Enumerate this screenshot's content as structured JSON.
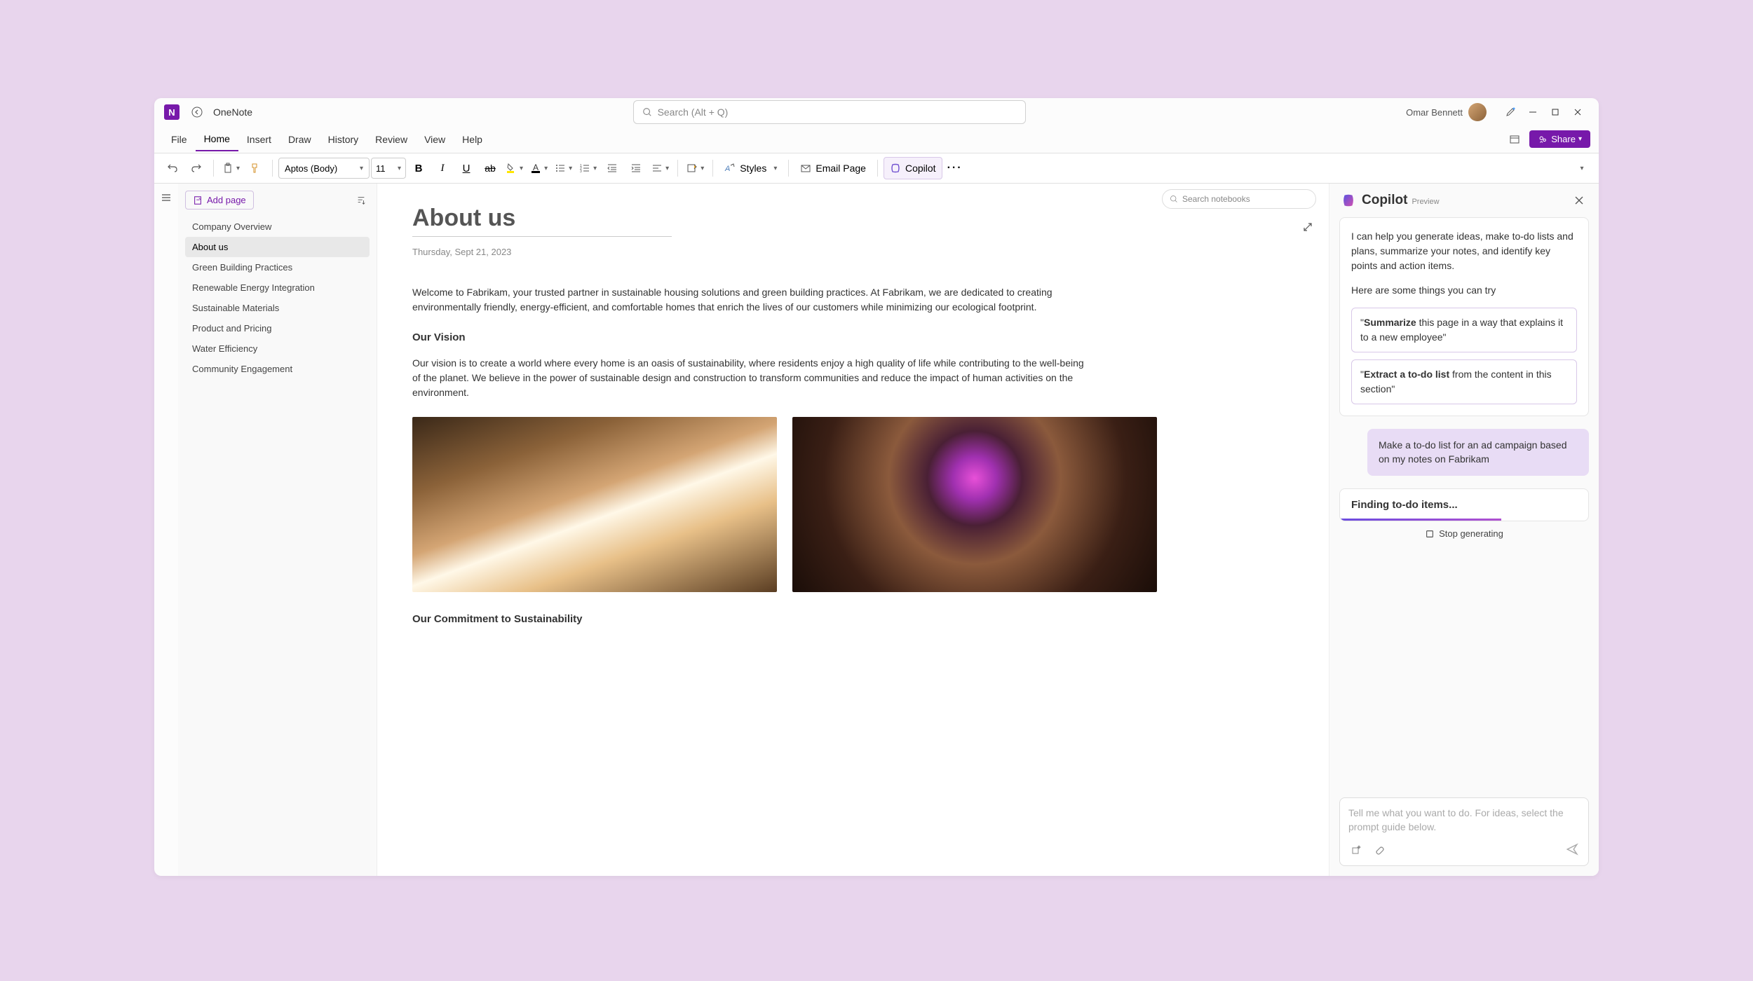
{
  "app": {
    "name": "OneNote"
  },
  "search": {
    "placeholder": "Search (Alt + Q)"
  },
  "user": {
    "name": "Omar Bennett"
  },
  "menu": {
    "items": [
      "File",
      "Home",
      "Insert",
      "Draw",
      "History",
      "Review",
      "View",
      "Help"
    ],
    "active": "Home"
  },
  "share": {
    "label": "Share"
  },
  "ribbon": {
    "font": "Aptos (Body)",
    "size": "11",
    "styles": "Styles",
    "email": "Email Page",
    "copilot": "Copilot"
  },
  "notebookSearch": {
    "placeholder": "Search notebooks"
  },
  "sidebar": {
    "addPage": "Add page",
    "items": [
      "Company Overview",
      "About us",
      "Green Building Practices",
      "Renewable Energy Integration",
      "Sustainable Materials",
      "Product and Pricing",
      "Water Efficiency",
      "Community Engagement"
    ],
    "active": 1
  },
  "page": {
    "title": "About us",
    "date": "Thursday, Sept 21, 2023",
    "intro": "Welcome to Fabrikam, your trusted partner in sustainable housing solutions and green building practices. At Fabrikam, we are dedicated to creating environmentally friendly, energy-efficient, and comfortable homes that enrich the lives of our customers while minimizing our ecological footprint.",
    "visionHeading": "Our Vision",
    "visionText": "Our vision is to create a world where every home is an oasis of sustainability, where residents enjoy a high quality of life while contributing to the well-being of the planet. We believe in the power of sustainable design and construction to transform communities and reduce the impact of human activities on the environment.",
    "commitmentHeading": "Our Commitment to Sustainability"
  },
  "copilot": {
    "title": "Copilot",
    "badge": "Preview",
    "intro": "I can help you generate ideas, make to-do lists and plans, summarize your notes, and identify key points and action items.",
    "tryText": "Here are some things you can try",
    "suggestion1_bold": "Summarize",
    "suggestion1_rest": " this page in a way that explains it to a new employee\"",
    "suggestion2_bold": "Extract a to-do list",
    "suggestion2_rest": " from the content in this section\"",
    "userMessage": "Make a to-do list for an ad campaign based on my notes on Fabrikam",
    "status": "Finding to-do items...",
    "stop": "Stop generating",
    "inputPlaceholder": "Tell me what you want to do. For ideas, select the prompt guide below."
  }
}
